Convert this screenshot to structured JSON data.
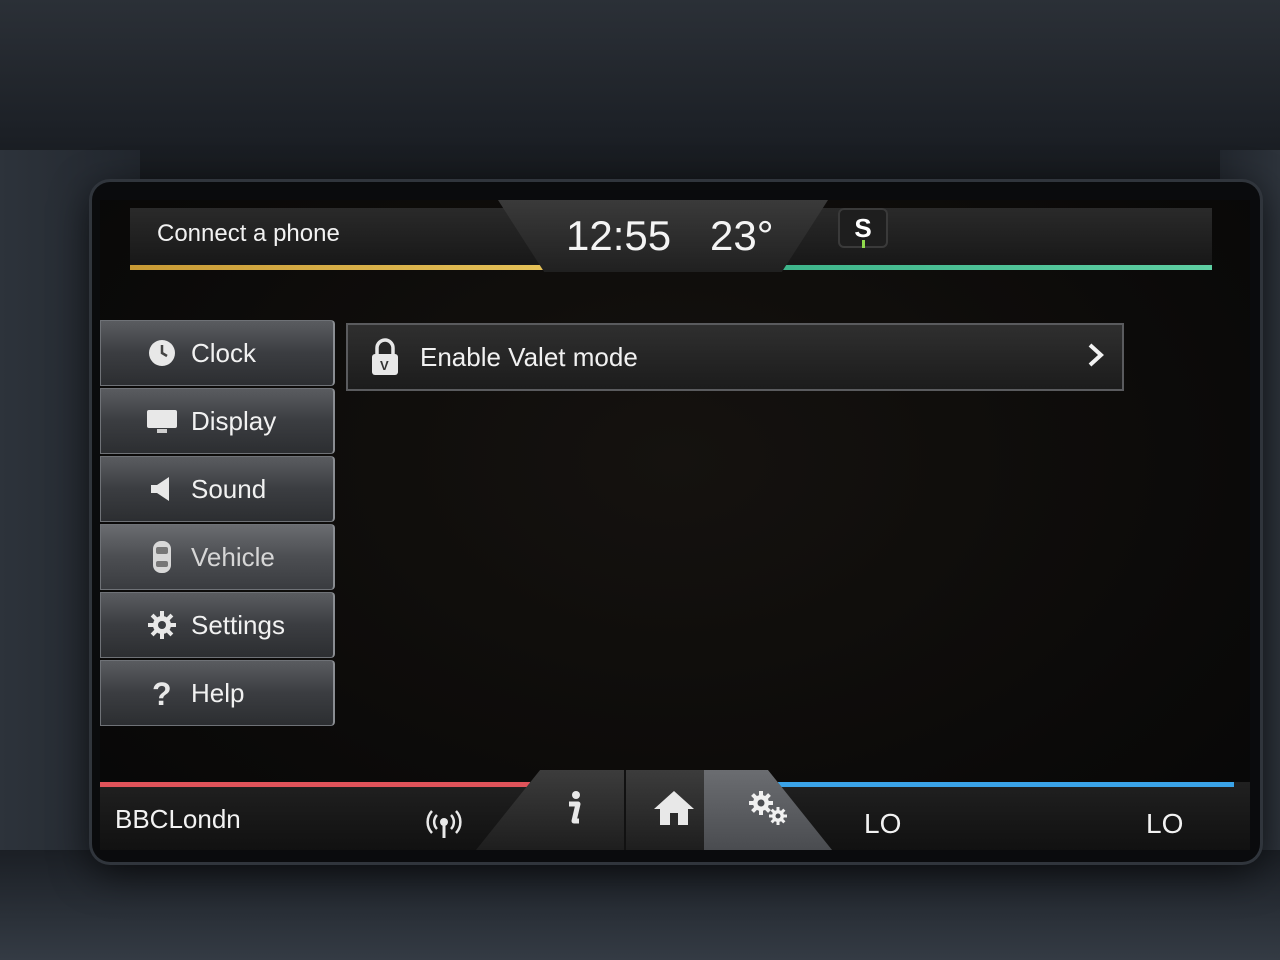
{
  "top_bar": {
    "phone_status": "Connect a phone",
    "time": "12:55",
    "temperature": "23°",
    "sync_badge": "S"
  },
  "menu": {
    "items": [
      {
        "label": "Clock",
        "icon": "clock-icon",
        "active": false
      },
      {
        "label": "Display",
        "icon": "display-icon",
        "active": false
      },
      {
        "label": "Sound",
        "icon": "speaker-icon",
        "active": false
      },
      {
        "label": "Vehicle",
        "icon": "car-icon",
        "active": true
      },
      {
        "label": "Settings",
        "icon": "gear-icon",
        "active": false
      },
      {
        "label": "Help",
        "icon": "help-icon",
        "active": false
      }
    ]
  },
  "main": {
    "valet_label": "Enable Valet mode",
    "lock_letter": "V"
  },
  "bottom_bar": {
    "station": "BBCLondn",
    "climate_left": "LO",
    "climate_right": "LO"
  },
  "colors": {
    "top_left_strip": "#e6c35a",
    "top_right_strip": "#5ecfa3",
    "bottom_left_strip": "#e0535a",
    "bottom_right_strip": "#3aa3e8"
  }
}
